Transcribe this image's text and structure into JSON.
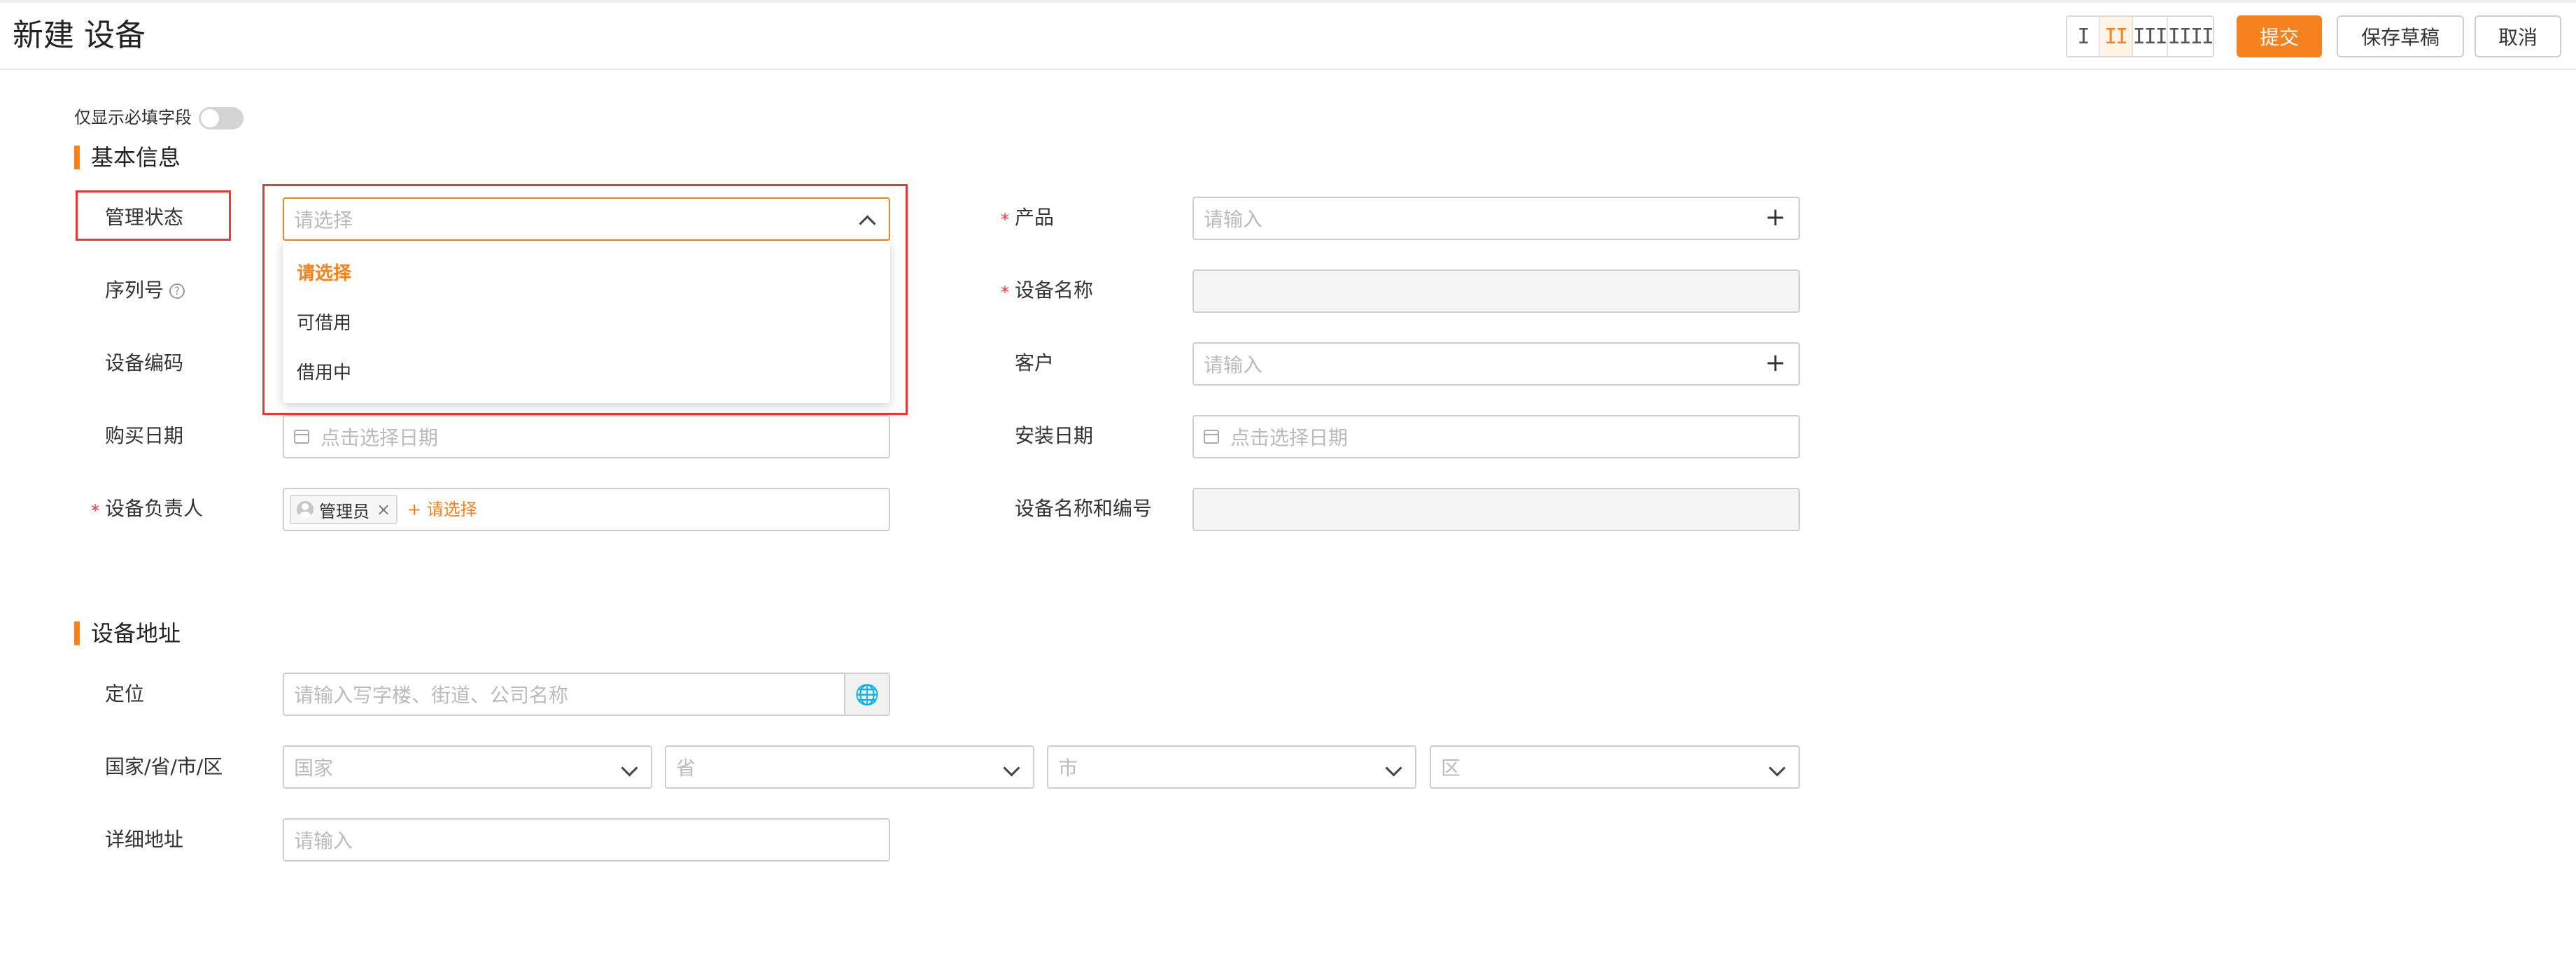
{
  "header": {
    "title": "新建 设备",
    "column_switch": [
      "I",
      "II",
      "III",
      "IIII"
    ],
    "active_column_index": 1,
    "submit_label": "提交",
    "save_draft_label": "保存草稿",
    "cancel_label": "取消"
  },
  "toggle": {
    "label": "仅显示必填字段",
    "on": false
  },
  "basic": {
    "title": "基本信息",
    "manage_status": {
      "label": "管理状态",
      "placeholder": "请选择"
    },
    "dropdown_options": [
      "请选择",
      "可借用",
      "借用中"
    ],
    "serial_no": {
      "label": "序列号",
      "help_icon": "question-circle-icon"
    },
    "device_code": {
      "label": "设备编码"
    },
    "purchase_date": {
      "label": "购买日期",
      "placeholder": "点击选择日期",
      "icon": "calendar-icon"
    },
    "owner": {
      "label": "设备负责人",
      "required_mark": "*",
      "tag": "管理员",
      "tag_close": "×",
      "add_label": "+ 请选择"
    },
    "product": {
      "label": "产品",
      "required_mark": "*",
      "placeholder": "请输入",
      "add_icon": "+"
    },
    "device_name": {
      "label": "设备名称",
      "required_mark": "*"
    },
    "customer": {
      "label": "客户",
      "placeholder": "请输入",
      "add_icon": "+"
    },
    "install_date": {
      "label": "安装日期",
      "placeholder": "点击选择日期",
      "icon": "calendar-icon"
    },
    "name_and_code": {
      "label": "设备名称和编号"
    }
  },
  "address": {
    "title": "设备地址",
    "location": {
      "label": "定位",
      "placeholder": "请输入写字楼、街道、公司名称",
      "icon": "globe-icon"
    },
    "region": {
      "label": "国家/省/市/区",
      "country": "国家",
      "province": "省",
      "city": "市",
      "district": "区"
    },
    "detail": {
      "label": "详细地址",
      "placeholder": "请输入"
    }
  },
  "colors": {
    "accent": "#f6821f",
    "required": "#e53935",
    "highlight_box": "#e53935"
  }
}
